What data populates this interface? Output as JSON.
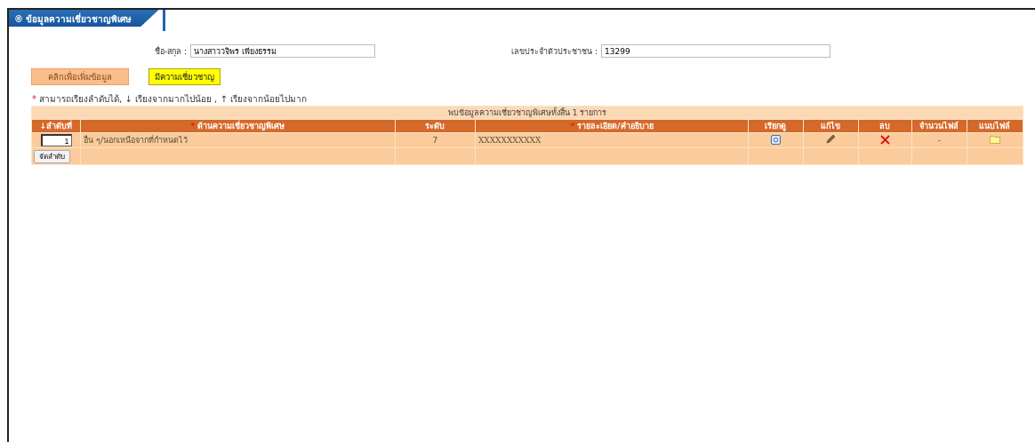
{
  "section_tab": {
    "label": "® ข้อมูลความเชี่ยวชาญพิเศษ"
  },
  "form": {
    "fields": [
      {
        "label": "ชื่อ-สกุล :",
        "value": "นางสาววจิพร เพียงธรรม"
      },
      {
        "label": "เลขประจำตัวประชาชน :",
        "value": "13299"
      }
    ]
  },
  "buttons": [
    {
      "label": "คลิกเพื่อเพิ่มข้อมูล",
      "kind": "add"
    },
    {
      "label": "มีความเชี่ยวชาญ",
      "kind": "status"
    }
  ],
  "sort_note": {
    "mark": "*",
    "text": "สามารถเรียงลำดับได้, ↓ เรียงจากมากไปน้อย , ↑ เรียงจากน้อยไปมาก"
  },
  "table": {
    "caption": "พบข้อมูลความเชี่ยวชาญพิเศษทั้งสิ้น 1 รายการ",
    "columns": [
      {
        "label": "↓ลำดับที่"
      },
      {
        "label": "ด้านความเชี่ยวชาญพิเศษ",
        "mark": "*"
      },
      {
        "label": "ระดับ"
      },
      {
        "label": "รายละเอียด/คำอธิบาย",
        "mark": "*"
      },
      {
        "label": "เรียกดู"
      },
      {
        "label": "แก้ไข"
      },
      {
        "label": "ลบ"
      },
      {
        "label": "จำนวนไฟล์"
      },
      {
        "label": "แนบไฟล์"
      }
    ],
    "rows": [
      {
        "order": "1",
        "expertise": "อื่น ๆ/นอกเหนือจากที่กำหนดไว้",
        "level": "7",
        "detail": "XXXXXXXXXXX",
        "file_count": "-"
      }
    ],
    "sort_button": "จัดลำดับ"
  }
}
